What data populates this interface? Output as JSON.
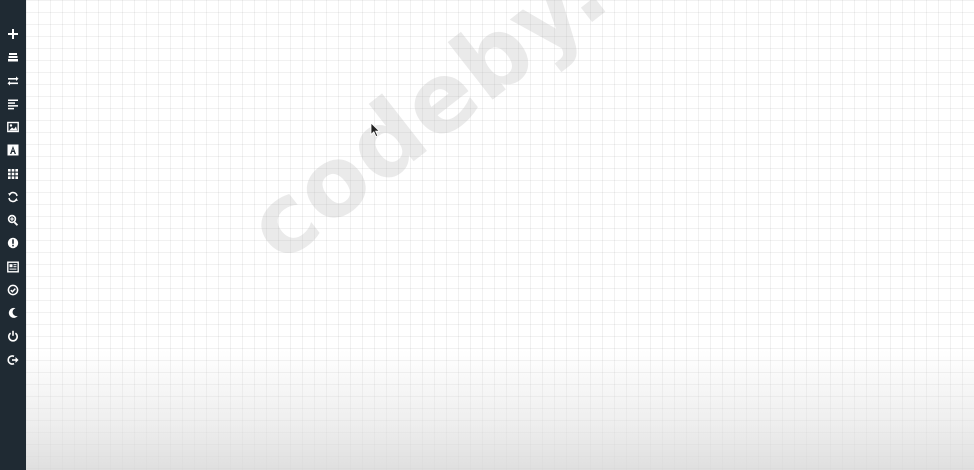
{
  "sidebar": {
    "background": "#1f2a33",
    "icon_color": "#ffffff",
    "items": [
      {
        "icon": "plus-icon"
      },
      {
        "icon": "database-icon"
      },
      {
        "icon": "swap-icon"
      },
      {
        "icon": "align-left-icon"
      },
      {
        "icon": "image-icon"
      },
      {
        "icon": "text-a-icon"
      },
      {
        "icon": "grid-icon"
      },
      {
        "icon": "refresh-icon"
      },
      {
        "icon": "zoom-search-icon"
      },
      {
        "icon": "info-icon"
      },
      {
        "icon": "document-list-icon"
      },
      {
        "icon": "check-circle-icon"
      },
      {
        "icon": "moon-icon"
      },
      {
        "icon": "power-icon"
      },
      {
        "icon": "logout-icon"
      }
    ]
  },
  "canvas": {
    "background": "#ffffff",
    "grid": true
  },
  "watermark": {
    "text": "codeby.net"
  },
  "cursor": {
    "icon": "mouse-pointer-icon"
  }
}
